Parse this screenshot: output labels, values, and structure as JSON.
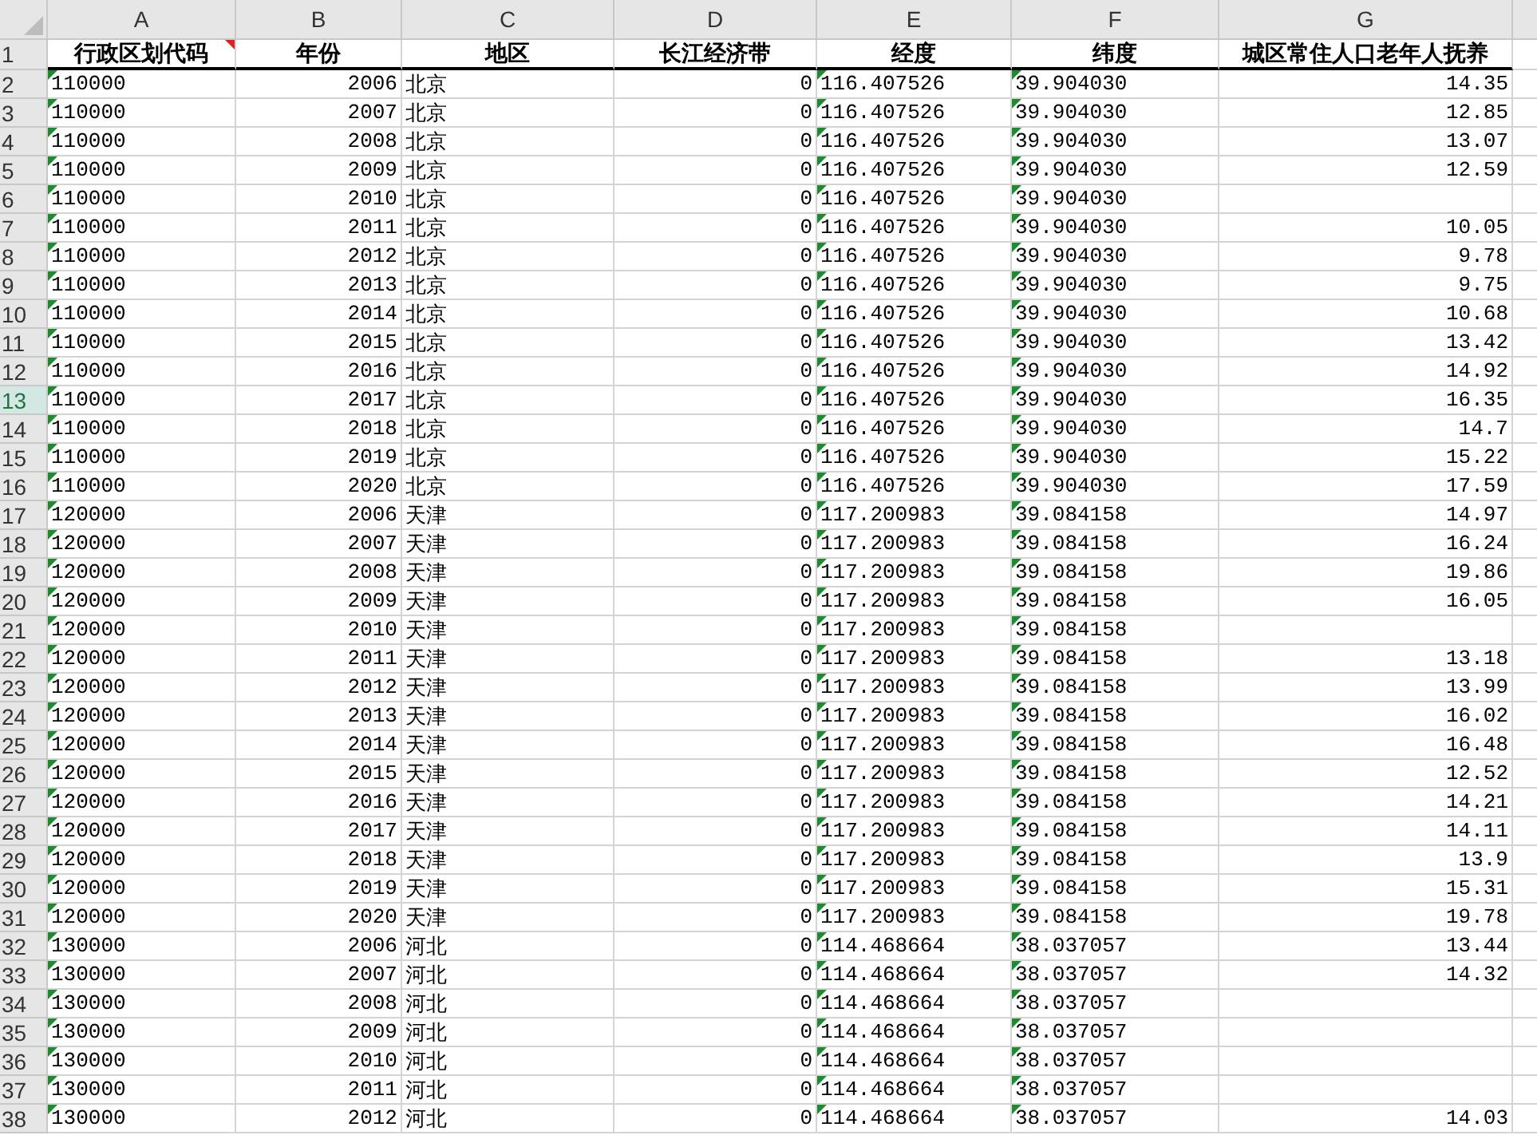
{
  "column_letters": [
    "A",
    "B",
    "C",
    "D",
    "E",
    "F",
    "G"
  ],
  "columns": [
    {
      "header": "行政区划代码",
      "kind": "text",
      "flagged": true,
      "comment": true
    },
    {
      "header": "年份",
      "kind": "number",
      "flagged": false,
      "comment": false
    },
    {
      "header": "地区",
      "kind": "text",
      "flagged": false,
      "comment": false
    },
    {
      "header": "长江经济带",
      "kind": "number",
      "flagged": false,
      "comment": false
    },
    {
      "header": "经度",
      "kind": "text",
      "flagged": true,
      "comment": false
    },
    {
      "header": "纬度",
      "kind": "text",
      "flagged": true,
      "comment": false
    },
    {
      "header": "城区常住人口老年人抚养",
      "kind": "number",
      "flagged": false,
      "comment": false
    }
  ],
  "header_row_number": "1",
  "rows": [
    {
      "number": "2",
      "selected": false,
      "cells": [
        "110000",
        "2006",
        "北京",
        "0",
        "116.407526",
        "39.904030",
        "14.35"
      ]
    },
    {
      "number": "3",
      "selected": false,
      "cells": [
        "110000",
        "2007",
        "北京",
        "0",
        "116.407526",
        "39.904030",
        "12.85"
      ]
    },
    {
      "number": "4",
      "selected": false,
      "cells": [
        "110000",
        "2008",
        "北京",
        "0",
        "116.407526",
        "39.904030",
        "13.07"
      ]
    },
    {
      "number": "5",
      "selected": false,
      "cells": [
        "110000",
        "2009",
        "北京",
        "0",
        "116.407526",
        "39.904030",
        "12.59"
      ]
    },
    {
      "number": "6",
      "selected": false,
      "cells": [
        "110000",
        "2010",
        "北京",
        "0",
        "116.407526",
        "39.904030",
        null
      ]
    },
    {
      "number": "7",
      "selected": false,
      "cells": [
        "110000",
        "2011",
        "北京",
        "0",
        "116.407526",
        "39.904030",
        "10.05"
      ]
    },
    {
      "number": "8",
      "selected": false,
      "cells": [
        "110000",
        "2012",
        "北京",
        "0",
        "116.407526",
        "39.904030",
        "9.78"
      ]
    },
    {
      "number": "9",
      "selected": false,
      "cells": [
        "110000",
        "2013",
        "北京",
        "0",
        "116.407526",
        "39.904030",
        "9.75"
      ]
    },
    {
      "number": "10",
      "selected": false,
      "cells": [
        "110000",
        "2014",
        "北京",
        "0",
        "116.407526",
        "39.904030",
        "10.68"
      ]
    },
    {
      "number": "11",
      "selected": false,
      "cells": [
        "110000",
        "2015",
        "北京",
        "0",
        "116.407526",
        "39.904030",
        "13.42"
      ]
    },
    {
      "number": "12",
      "selected": false,
      "cells": [
        "110000",
        "2016",
        "北京",
        "0",
        "116.407526",
        "39.904030",
        "14.92"
      ]
    },
    {
      "number": "13",
      "selected": true,
      "cells": [
        "110000",
        "2017",
        "北京",
        "0",
        "116.407526",
        "39.904030",
        "16.35"
      ]
    },
    {
      "number": "14",
      "selected": false,
      "cells": [
        "110000",
        "2018",
        "北京",
        "0",
        "116.407526",
        "39.904030",
        "14.7"
      ]
    },
    {
      "number": "15",
      "selected": false,
      "cells": [
        "110000",
        "2019",
        "北京",
        "0",
        "116.407526",
        "39.904030",
        "15.22"
      ]
    },
    {
      "number": "16",
      "selected": false,
      "cells": [
        "110000",
        "2020",
        "北京",
        "0",
        "116.407526",
        "39.904030",
        "17.59"
      ]
    },
    {
      "number": "17",
      "selected": false,
      "cells": [
        "120000",
        "2006",
        "天津",
        "0",
        "117.200983",
        "39.084158",
        "14.97"
      ]
    },
    {
      "number": "18",
      "selected": false,
      "cells": [
        "120000",
        "2007",
        "天津",
        "0",
        "117.200983",
        "39.084158",
        "16.24"
      ]
    },
    {
      "number": "19",
      "selected": false,
      "cells": [
        "120000",
        "2008",
        "天津",
        "0",
        "117.200983",
        "39.084158",
        "19.86"
      ]
    },
    {
      "number": "20",
      "selected": false,
      "cells": [
        "120000",
        "2009",
        "天津",
        "0",
        "117.200983",
        "39.084158",
        "16.05"
      ]
    },
    {
      "number": "21",
      "selected": false,
      "cells": [
        "120000",
        "2010",
        "天津",
        "0",
        "117.200983",
        "39.084158",
        null
      ]
    },
    {
      "number": "22",
      "selected": false,
      "cells": [
        "120000",
        "2011",
        "天津",
        "0",
        "117.200983",
        "39.084158",
        "13.18"
      ]
    },
    {
      "number": "23",
      "selected": false,
      "cells": [
        "120000",
        "2012",
        "天津",
        "0",
        "117.200983",
        "39.084158",
        "13.99"
      ]
    },
    {
      "number": "24",
      "selected": false,
      "cells": [
        "120000",
        "2013",
        "天津",
        "0",
        "117.200983",
        "39.084158",
        "16.02"
      ]
    },
    {
      "number": "25",
      "selected": false,
      "cells": [
        "120000",
        "2014",
        "天津",
        "0",
        "117.200983",
        "39.084158",
        "16.48"
      ]
    },
    {
      "number": "26",
      "selected": false,
      "cells": [
        "120000",
        "2015",
        "天津",
        "0",
        "117.200983",
        "39.084158",
        "12.52"
      ]
    },
    {
      "number": "27",
      "selected": false,
      "cells": [
        "120000",
        "2016",
        "天津",
        "0",
        "117.200983",
        "39.084158",
        "14.21"
      ]
    },
    {
      "number": "28",
      "selected": false,
      "cells": [
        "120000",
        "2017",
        "天津",
        "0",
        "117.200983",
        "39.084158",
        "14.11"
      ]
    },
    {
      "number": "29",
      "selected": false,
      "cells": [
        "120000",
        "2018",
        "天津",
        "0",
        "117.200983",
        "39.084158",
        "13.9"
      ]
    },
    {
      "number": "30",
      "selected": false,
      "cells": [
        "120000",
        "2019",
        "天津",
        "0",
        "117.200983",
        "39.084158",
        "15.31"
      ]
    },
    {
      "number": "31",
      "selected": false,
      "cells": [
        "120000",
        "2020",
        "天津",
        "0",
        "117.200983",
        "39.084158",
        "19.78"
      ]
    },
    {
      "number": "32",
      "selected": false,
      "cells": [
        "130000",
        "2006",
        "河北",
        "0",
        "114.468664",
        "38.037057",
        "13.44"
      ]
    },
    {
      "number": "33",
      "selected": false,
      "cells": [
        "130000",
        "2007",
        "河北",
        "0",
        "114.468664",
        "38.037057",
        "14.32"
      ]
    },
    {
      "number": "34",
      "selected": false,
      "cells": [
        "130000",
        "2008",
        "河北",
        "0",
        "114.468664",
        "38.037057",
        null
      ]
    },
    {
      "number": "35",
      "selected": false,
      "cells": [
        "130000",
        "2009",
        "河北",
        "0",
        "114.468664",
        "38.037057",
        null
      ]
    },
    {
      "number": "36",
      "selected": false,
      "cells": [
        "130000",
        "2010",
        "河北",
        "0",
        "114.468664",
        "38.037057",
        null
      ]
    },
    {
      "number": "37",
      "selected": false,
      "cells": [
        "130000",
        "2011",
        "河北",
        "0",
        "114.468664",
        "38.037057",
        null
      ]
    },
    {
      "number": "38",
      "selected": false,
      "cells": [
        "130000",
        "2012",
        "河北",
        "0",
        "114.468664",
        "38.037057",
        "14.03"
      ]
    }
  ]
}
